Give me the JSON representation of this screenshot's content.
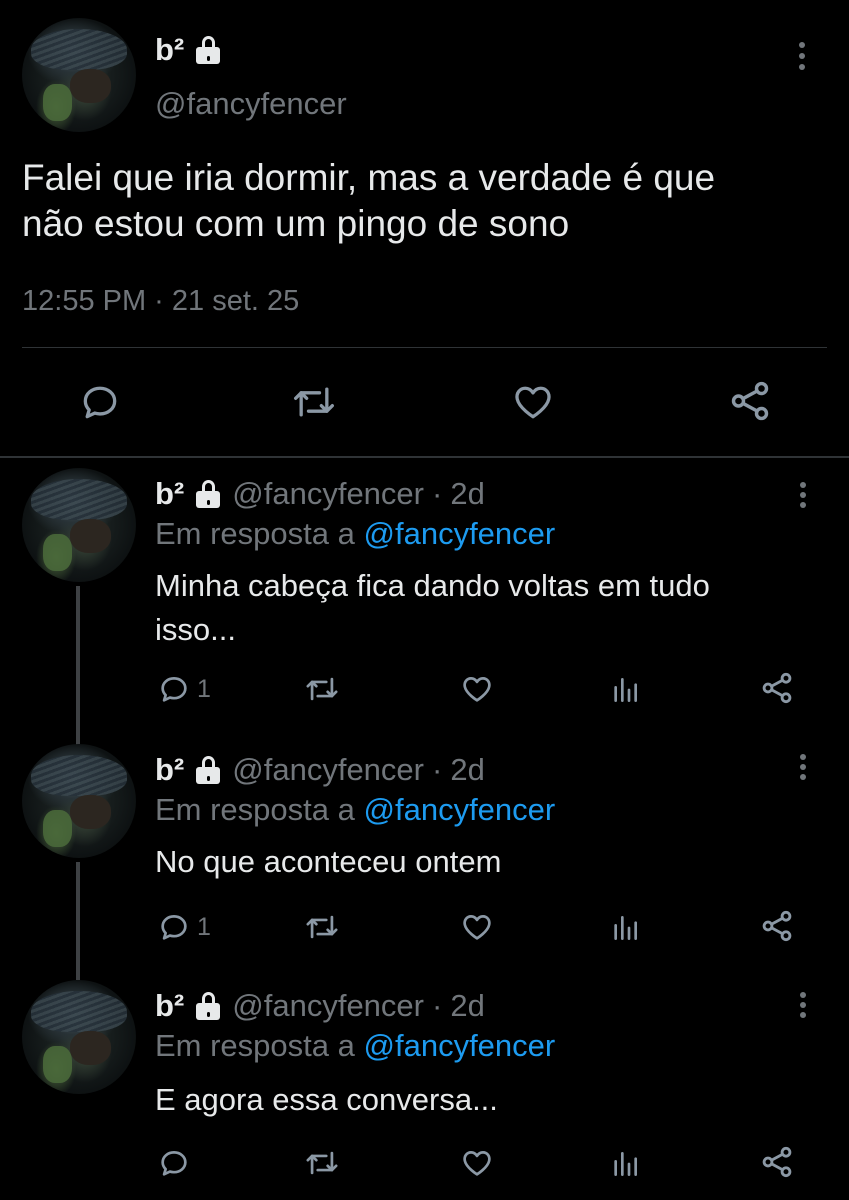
{
  "main_tweet": {
    "display_name": "b²",
    "handle": "@fancyfencer",
    "text_line1": "Falei que iria dormir, mas a verdade é que",
    "text_line2": "não estou com um pingo de sono",
    "timestamp": "12:55 PM · 21 set. 25"
  },
  "replies": [
    {
      "display_name": "b²",
      "handle": "@fancyfencer",
      "separator": "·",
      "time": "2d",
      "reply_to_label": "Em resposta a",
      "reply_to_mention": "@fancyfencer",
      "text_line1": "Minha cabeça fica dando voltas em tudo",
      "text_line2": "isso...",
      "reply_count": "1"
    },
    {
      "display_name": "b²",
      "handle": "@fancyfencer",
      "separator": "·",
      "time": "2d",
      "reply_to_label": "Em resposta a",
      "reply_to_mention": "@fancyfencer",
      "text_line1": "No que aconteceu ontem",
      "reply_count": "1"
    },
    {
      "display_name": "b²",
      "handle": "@fancyfencer",
      "separator": "·",
      "time": "2d",
      "reply_to_label": "Em resposta a",
      "reply_to_mention": "@fancyfencer",
      "text_line1": "E agora essa conversa...",
      "reply_count": ""
    }
  ],
  "colors": {
    "background": "#000000",
    "text": "#e7e9ea",
    "secondary": "#71767b",
    "link": "#1d9bf0",
    "divider": "#2f3336"
  },
  "icons": [
    "lock-icon",
    "more-icon",
    "reply-icon",
    "retweet-icon",
    "like-icon",
    "views-icon",
    "share-icon"
  ]
}
